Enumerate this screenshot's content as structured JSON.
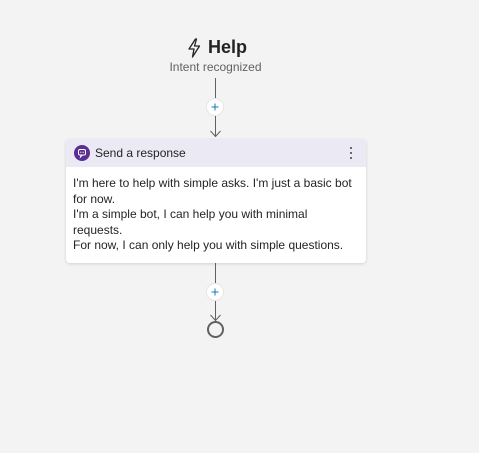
{
  "trigger": {
    "icon": "lightning-icon",
    "title": "Help",
    "subtitle": "Intent recognized"
  },
  "response_card": {
    "icon": "message-bot-icon",
    "title": "Send a response",
    "menu_icon": "more-vertical-icon",
    "messages": [
      " I'm here to help with simple asks. I'm just a basic bot for now.",
      " I'm a simple bot, I can help you with minimal requests.",
      " For now, I can only help you with simple questions."
    ]
  },
  "colors": {
    "canvas_background": "#f3f3f3",
    "card_header": "#ebe9f3",
    "card_icon_accent": "#5b2f91",
    "connector": "#616161",
    "add_button_plus": "#0f7fb0"
  }
}
